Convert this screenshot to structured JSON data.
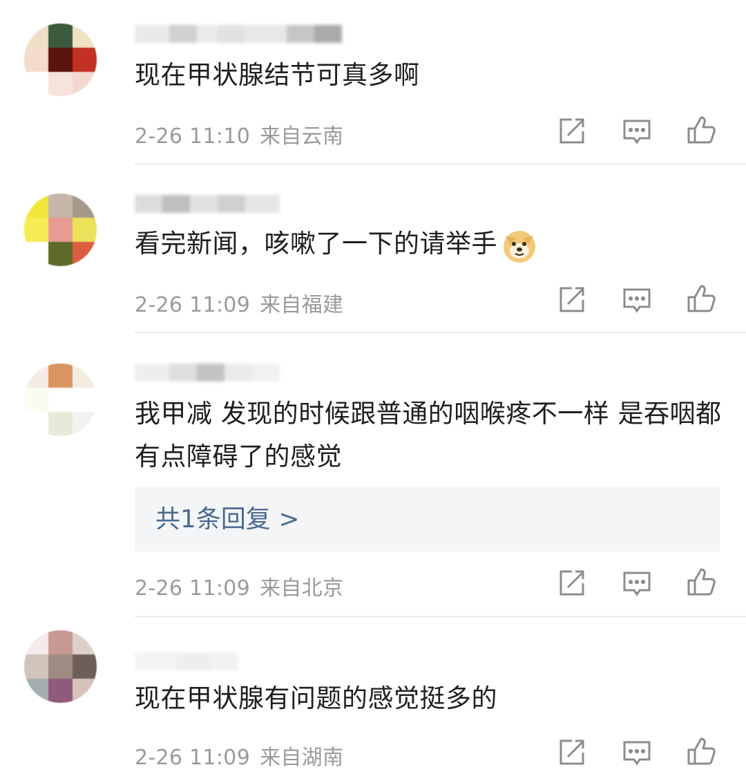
{
  "comments": [
    {
      "text": "现在甲状腺结节可真多啊",
      "time": "2-26 11:10",
      "location": "来自云南",
      "avatar_colors": [
        "#f0dfc8",
        "#3c5a3e",
        "#efe2c2",
        "#f3dcc9",
        "#5b1410",
        "#c33024",
        "#ffffff",
        "#f8e3da",
        "#f3d8cf"
      ],
      "name_colors": [
        "#e6e6e6",
        "#c9c9c9",
        "#e8e8e8",
        "#dcdcdc",
        "#e5e5e5",
        "#bdbdbd",
        "#9c9c9c"
      ]
    },
    {
      "text": "看完新闻，咳嗽了一下的请举手",
      "time": "2-26 11:09",
      "location": "来自福建",
      "avatar_colors": [
        "#f2e63a",
        "#c6b6aa",
        "#a5998c",
        "#f5ec55",
        "#e69c92",
        "#ece15a",
        "#ffffff",
        "#5e6b28",
        "#dc5d42"
      ],
      "name_colors": [
        "#d6d6d6",
        "#b4b4b4",
        "#dddddd",
        "#c8c8c8",
        "#e2e2e2"
      ]
    },
    {
      "text": "我甲减 发现的时候跟普通的咽喉疼不一样 是吞咽都有点障碍了的感觉",
      "time": "2-26 11:09",
      "location": "来自北京",
      "reply": "共1条回复 >",
      "avatar_colors": [
        "#f6ebe6",
        "#d9955f",
        "#f3ece3",
        "#fbfbf4",
        "#ffffff",
        "#ffffff",
        "#ffffff",
        "#e6ead9",
        "#f2f2f2"
      ],
      "name_colors": [
        "#ececec",
        "#d9d9d9",
        "#b9b9b9",
        "#e8e8e8",
        "#efefef"
      ]
    },
    {
      "text": "现在甲状腺有问题的感觉挺多的",
      "time": "2-26 11:09",
      "location": "来自湖南",
      "avatar_colors": [
        "#f4ecea",
        "#c89892",
        "#ddd0ca",
        "#d1c4bb",
        "#9e8c84",
        "#6d5e58",
        "#a3aeae",
        "#8f5a7c",
        "#d8c3bc"
      ],
      "name_colors": [
        "#f2f2f2",
        "#ececec",
        "#f0f0f0"
      ]
    }
  ],
  "icons": [
    "share-icon",
    "comment-icon",
    "like-icon"
  ],
  "emoji": "doge-emoji"
}
